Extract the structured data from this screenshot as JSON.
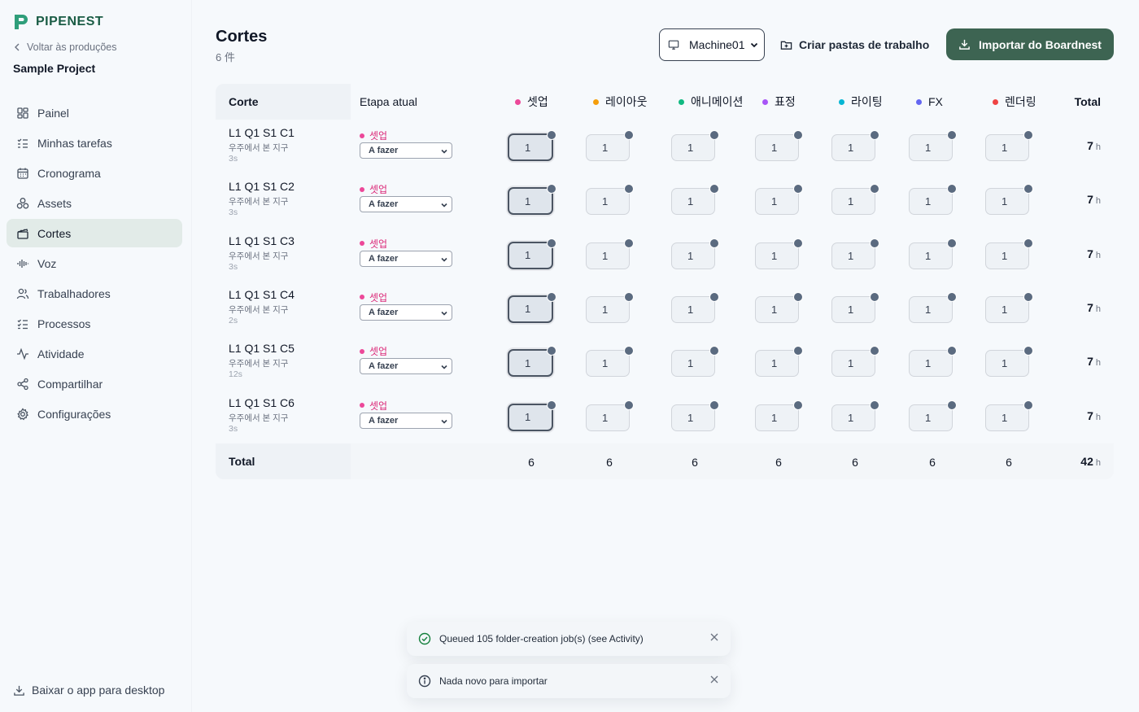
{
  "brand": {
    "name": "PIPENEST",
    "accent": "#1a5c45"
  },
  "sidebar": {
    "back_label": "Voltar às produções",
    "project_name": "Sample Project",
    "items": [
      {
        "label": "Painel",
        "icon": "dashboard-icon"
      },
      {
        "label": "Minhas tarefas",
        "icon": "tasks-icon"
      },
      {
        "label": "Cronograma",
        "icon": "calendar-icon"
      },
      {
        "label": "Assets",
        "icon": "assets-icon"
      },
      {
        "label": "Cortes",
        "icon": "clapper-icon",
        "active": true
      },
      {
        "label": "Voz",
        "icon": "audio-wave-icon"
      },
      {
        "label": "Trabalhadores",
        "icon": "users-icon"
      },
      {
        "label": "Processos",
        "icon": "checklist-icon"
      },
      {
        "label": "Atividade",
        "icon": "activity-icon"
      },
      {
        "label": "Compartilhar",
        "icon": "share-icon"
      },
      {
        "label": "Configurações",
        "icon": "gear-icon"
      }
    ],
    "desktop_label": "Baixar o app para desktop"
  },
  "header": {
    "title": "Cortes",
    "count": "6 件",
    "machine": "Machine01",
    "create_folders_label": "Criar pastas de trabalho",
    "import_label": "Importar do Boardnest",
    "import_color": "#3d6452"
  },
  "table": {
    "col_shot": "Corte",
    "col_stage": "Etapa atual",
    "col_total": "Total",
    "stages": [
      {
        "label": "셋업",
        "color": "#ec4899"
      },
      {
        "label": "레이아웃",
        "color": "#f59e0b"
      },
      {
        "label": "애니메이션",
        "color": "#10b981"
      },
      {
        "label": "표정",
        "color": "#a855f7"
      },
      {
        "label": "라이팅",
        "color": "#06b6d4"
      },
      {
        "label": "FX",
        "color": "#6366f1"
      },
      {
        "label": "렌더링",
        "color": "#ef4444"
      }
    ],
    "rows": [
      {
        "name": "L1 Q1 S1 C1",
        "desc": "우주에서 본 지구",
        "dur": "3s",
        "stage": "셋업",
        "status": "A fazer",
        "cells": [
          "1",
          "1",
          "1",
          "1",
          "1",
          "1",
          "1"
        ],
        "total": "7",
        "unit": "h"
      },
      {
        "name": "L1 Q1 S1 C2",
        "desc": "우주에서 본 지구",
        "dur": "3s",
        "stage": "셋업",
        "status": "A fazer",
        "cells": [
          "1",
          "1",
          "1",
          "1",
          "1",
          "1",
          "1"
        ],
        "total": "7",
        "unit": "h"
      },
      {
        "name": "L1 Q1 S1 C3",
        "desc": "우주에서 본 지구",
        "dur": "3s",
        "stage": "셋업",
        "status": "A fazer",
        "cells": [
          "1",
          "1",
          "1",
          "1",
          "1",
          "1",
          "1"
        ],
        "total": "7",
        "unit": "h"
      },
      {
        "name": "L1 Q1 S1 C4",
        "desc": "우주에서 본 지구",
        "dur": "2s",
        "stage": "셋업",
        "status": "A fazer",
        "cells": [
          "1",
          "1",
          "1",
          "1",
          "1",
          "1",
          "1"
        ],
        "total": "7",
        "unit": "h"
      },
      {
        "name": "L1 Q1 S1 C5",
        "desc": "우주에서 본 지구",
        "dur": "12s",
        "stage": "셋업",
        "status": "A fazer",
        "cells": [
          "1",
          "1",
          "1",
          "1",
          "1",
          "1",
          "1"
        ],
        "total": "7",
        "unit": "h"
      },
      {
        "name": "L1 Q1 S1 C6",
        "desc": "우주에서 본 지구",
        "dur": "3s",
        "stage": "셋업",
        "status": "A fazer",
        "cells": [
          "1",
          "1",
          "1",
          "1",
          "1",
          "1",
          "1"
        ],
        "total": "7",
        "unit": "h"
      }
    ],
    "footer": {
      "label": "Total",
      "values": [
        "6",
        "6",
        "6",
        "6",
        "6",
        "6",
        "6"
      ],
      "total": "42",
      "unit": "h"
    }
  },
  "toasts": [
    {
      "text": "Queued 105 folder-creation job(s) (see Activity)",
      "icon": "check-circle-icon"
    },
    {
      "text": "Nada novo para importar",
      "icon": "info-circle-icon"
    }
  ]
}
